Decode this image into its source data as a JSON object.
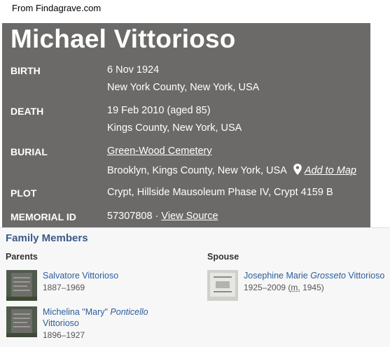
{
  "source_note": "From Findagrave.com",
  "memorial": {
    "name": "Michael Vittorioso",
    "birth": {
      "label": "BIRTH",
      "date": "6 Nov 1924",
      "place": "New York County, New York, USA"
    },
    "death": {
      "label": "DEATH",
      "date": "19 Feb 2010 (aged 85)",
      "place": "Kings County, New York, USA"
    },
    "burial": {
      "label": "BURIAL",
      "cemetery": "Green-Wood Cemetery",
      "place": "Brooklyn, Kings County, New York, USA",
      "map_link": "Add to Map"
    },
    "plot": {
      "label": "PLOT",
      "value": "Crypt, Hillside Mausoleum Phase IV, Crypt 4159 B"
    },
    "memorial_id": {
      "label": "MEMORIAL ID",
      "value": "57307808",
      "separator": " · ",
      "source_link": "View Source"
    }
  },
  "family": {
    "title": "Family Members",
    "parents_label": "Parents",
    "spouse_label": "Spouse",
    "parents": [
      {
        "name": "Salvatore Vittorioso",
        "dates": "1887–1969"
      },
      {
        "name_first": "Michelina \"Mary\" ",
        "name_maiden": "Ponticello",
        "name_last": "Vittorioso",
        "dates": "1896–1927"
      }
    ],
    "spouse": {
      "name_first": "Josephine Marie ",
      "name_maiden": "Grosseto",
      "name_last": " Vittorioso",
      "dates": "1925–2009 (",
      "married_abbr": "m.",
      "married_year": " 1945)"
    }
  },
  "colors": {
    "panel_bg": "#6b6a68",
    "link_blue": "#2a5d9c",
    "family_title": "#3b5a8a"
  }
}
